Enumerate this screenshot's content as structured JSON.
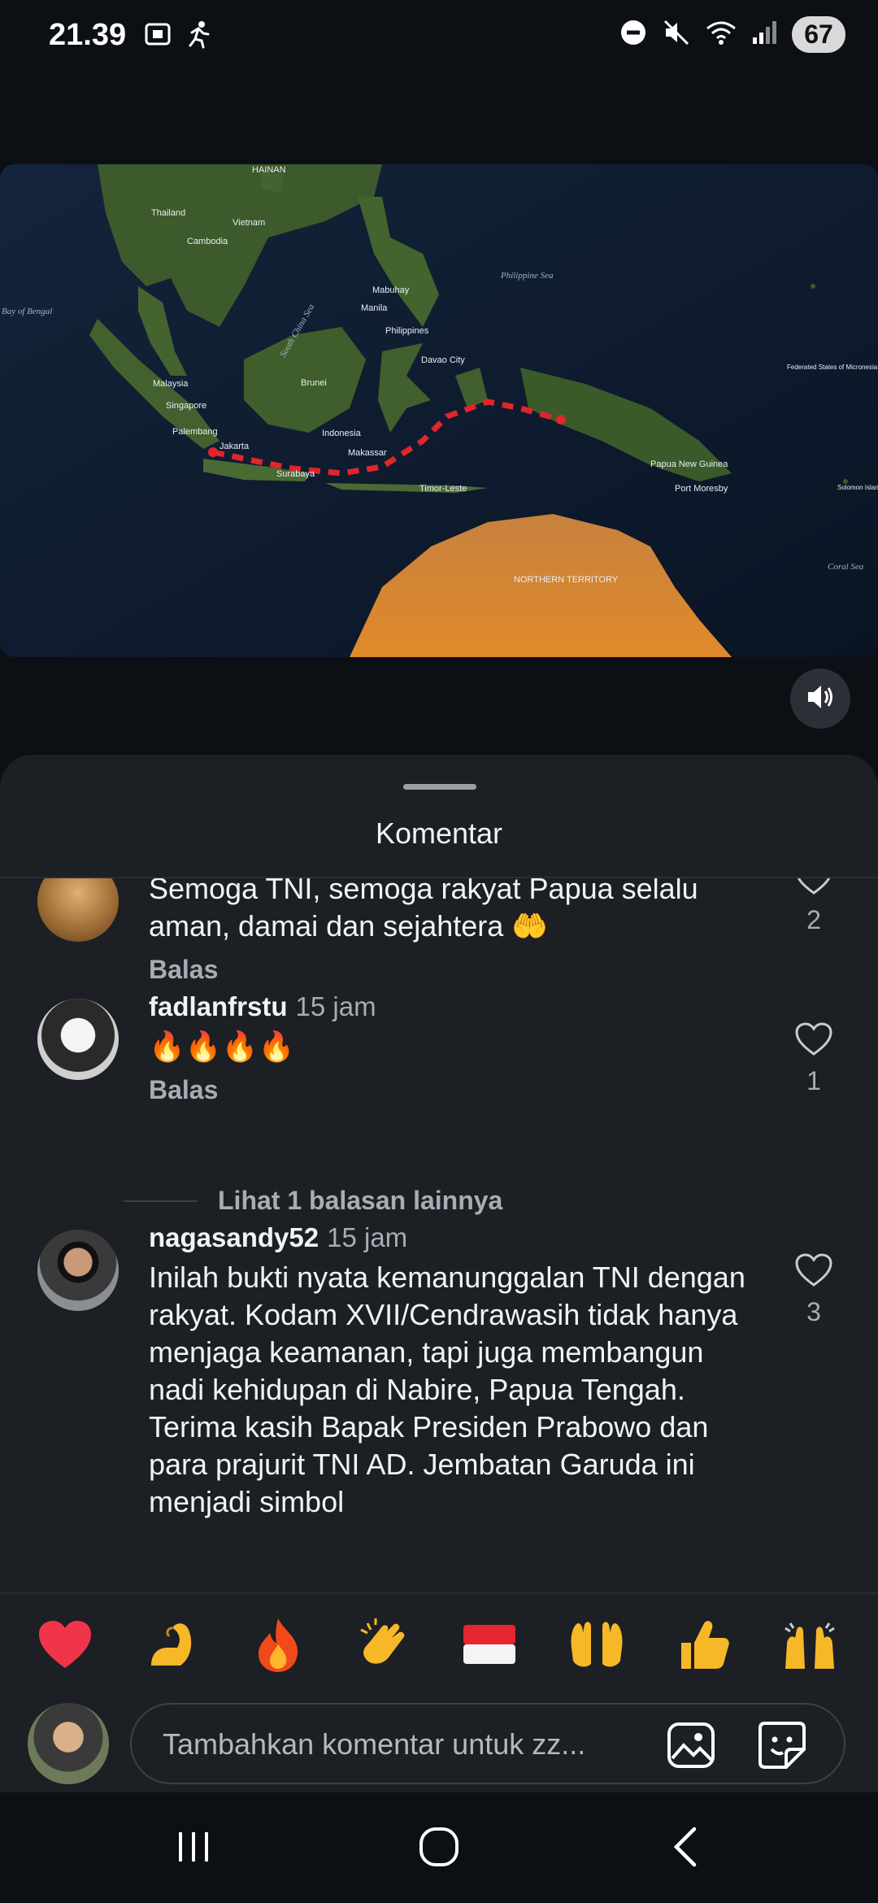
{
  "status_bar": {
    "time": "21.39",
    "battery": "67",
    "icons": [
      "screenshot-icon",
      "activity-icon",
      "dnd-icon",
      "mute-icon",
      "wifi-icon",
      "signal-icon"
    ]
  },
  "video": {
    "map_labels": [
      "HAINAN",
      "Thailand",
      "Vietnam",
      "Cambodia",
      "Malaysia",
      "Singapore",
      "Palembang",
      "Jakarta",
      "Surabaya",
      "Indonesia",
      "Makassar",
      "Brunei",
      "Philippines",
      "Manila",
      "Mabuhay",
      "Davao City",
      "Timor-Leste",
      "Papua New Guinea",
      "Port Moresby",
      "NORTHERN TERRITORY",
      "Coral Sea",
      "Federated States of Micronesia",
      "Solomon Islands",
      "Bay of Bengal",
      "Philippine Sea",
      "South China Sea"
    ],
    "mute_icon": "speaker-icon"
  },
  "sheet": {
    "title": "Komentar"
  },
  "comments": [
    {
      "username": "",
      "time": "",
      "text": "Semoga TNI, semoga rakyat Papua selalu aman, damai dan sejahtera 🤲",
      "reply_label": "Balas",
      "likes": "2"
    },
    {
      "username": "fadlanfrstu",
      "time": "15 jam",
      "text": "🔥🔥🔥🔥",
      "reply_label": "Balas",
      "likes": "1",
      "more_replies": "Lihat 1 balasan lainnya"
    },
    {
      "username": "nagasandy52",
      "time": "15 jam",
      "text": "Inilah bukti nyata kemanunggalan TNI dengan rakyat. Kodam XVII/Cendrawasih tidak hanya menjaga keamanan, tapi juga membangun nadi kehidupan di Nabire, Papua Tengah. Terima kasih Bapak Presiden Prabowo dan para prajurit TNI AD. Jembatan Garuda ini menjadi simbol",
      "likes": "3"
    }
  ],
  "emoji_bar": [
    "❤️",
    "💪",
    "🔥",
    "👏",
    "🇮🇩",
    "🤲",
    "👍",
    "🙌"
  ],
  "input": {
    "placeholder": "Tambahkan komentar untuk zz..."
  },
  "colors": {
    "background": "#0c0f14",
    "sheet": "#1c1f24",
    "route": "#e0262b",
    "secondary_text": "#a8adb4"
  }
}
